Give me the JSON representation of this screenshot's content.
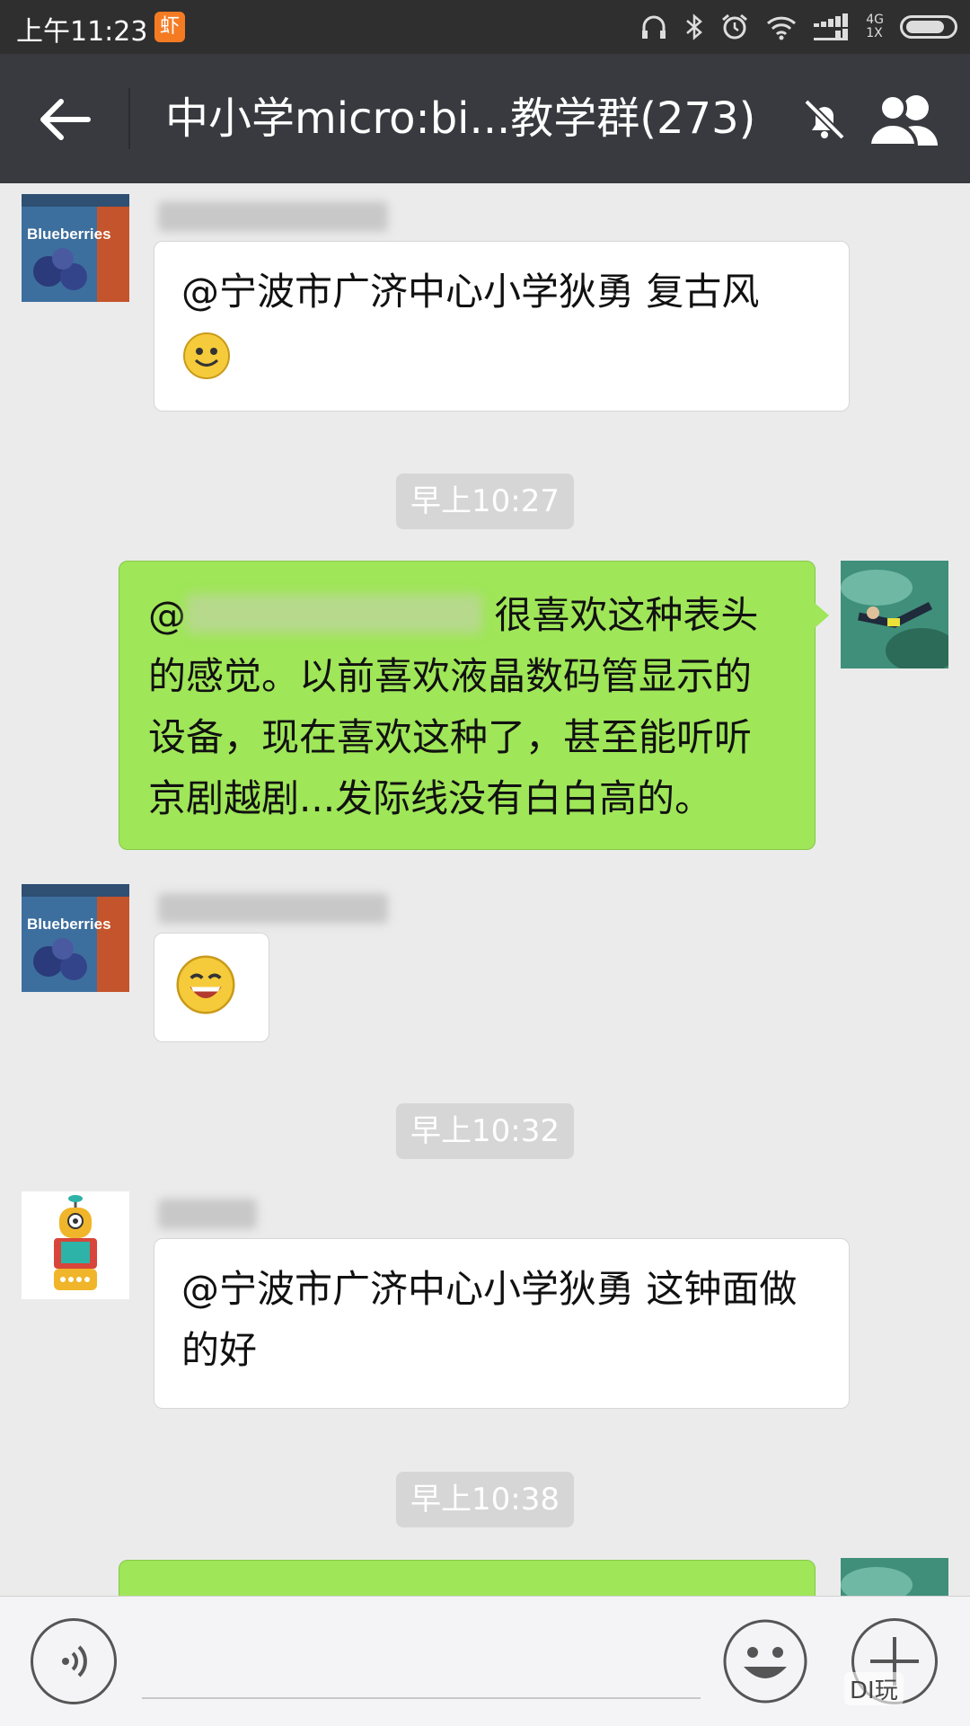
{
  "status_bar": {
    "time": "上午11:23",
    "app_badge": "虾",
    "network_top": "4G",
    "network_bottom": "1X"
  },
  "header": {
    "title": "中小学micro:bi...教学群(273)"
  },
  "messages": [
    {
      "text": "@宁波市广济中心小学狄勇 复古风"
    },
    {
      "timestamp": "早上10:27"
    },
    {
      "prefix": "@",
      "text": " 很喜欢这种表头的感觉。以前喜欢液晶数码管显示的设备，现在喜欢这种了，甚至能听听京剧越剧...发际线没有白白高的。"
    },
    {
      "timestamp": "早上10:32"
    },
    {
      "text": "@宁波市广济中心小学狄勇 这钟面做的好"
    },
    {
      "timestamp": "早上10:38"
    }
  ],
  "avatars": {
    "blueberry_label": "Blueberries"
  },
  "watermark": "DI玩"
}
